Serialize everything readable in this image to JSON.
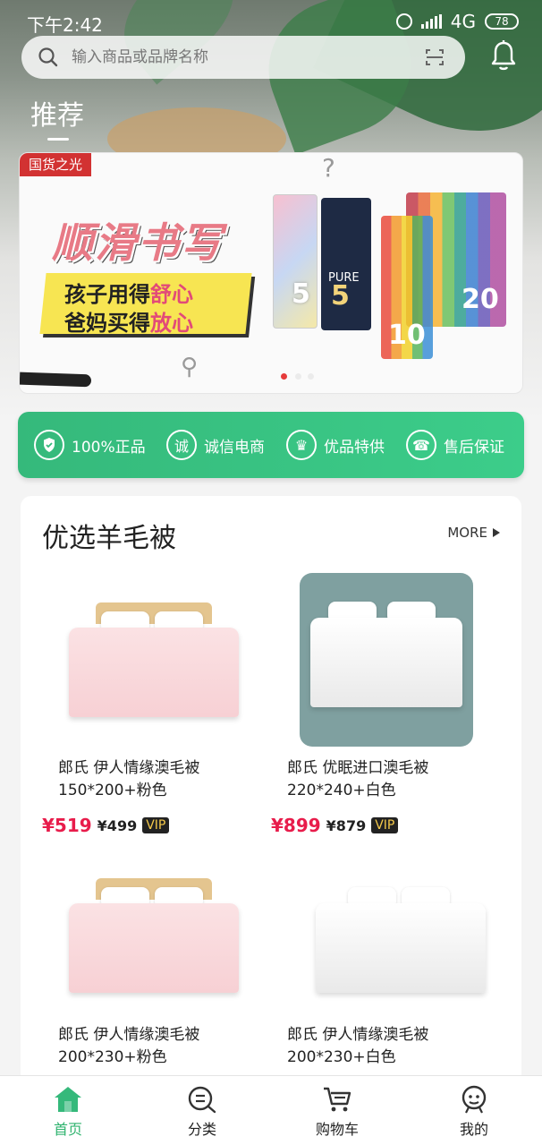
{
  "status_bar": {
    "time": "下午2:42",
    "network": "4G",
    "battery": "78"
  },
  "search": {
    "placeholder": "输入商品或品牌名称"
  },
  "top_tab": {
    "label": "推荐"
  },
  "banner": {
    "tag": "国货之光",
    "headline": "顺滑书写",
    "line1_prefix": "孩子用得",
    "line1_highlight": "舒心",
    "line2_prefix": "爸妈买得",
    "line2_highlight": "放心",
    "pack_label": "PURE",
    "pack_numbers": [
      "5",
      "5",
      "10",
      "20"
    ],
    "active_slide": 1,
    "slide_count": 3
  },
  "guarantees": [
    {
      "icon": "shield-icon",
      "label": "100%正品"
    },
    {
      "icon": "honest-icon",
      "label": "诚信电商"
    },
    {
      "icon": "crown-icon",
      "label": "优品特供"
    },
    {
      "icon": "service-icon",
      "label": "售后保证"
    }
  ],
  "section": {
    "title": "优选羊毛被",
    "more_label": "MORE"
  },
  "products": [
    {
      "name_line1": "郎氏 伊人情缘澳毛被",
      "name_line2": "150*200+粉色",
      "price": "¥519",
      "vip_price": "¥499",
      "vip_label": "VIP"
    },
    {
      "name_line1": "郎氏 优眠进口澳毛被",
      "name_line2": "220*240+白色",
      "price": "¥899",
      "vip_price": "¥879",
      "vip_label": "VIP"
    },
    {
      "name_line1": "郎氏 伊人情缘澳毛被",
      "name_line2": "200*230+粉色"
    },
    {
      "name_line1": "郎氏 伊人情缘澳毛被",
      "name_line2": "200*230+白色"
    }
  ],
  "bottom_nav": [
    {
      "label": "首页",
      "icon": "home-icon",
      "active": true
    },
    {
      "label": "分类",
      "icon": "category-icon",
      "active": false
    },
    {
      "label": "购物车",
      "icon": "cart-icon",
      "active": false
    },
    {
      "label": "我的",
      "icon": "profile-icon",
      "active": false
    }
  ],
  "colors": {
    "accent_green": "#35b97b",
    "price_red": "#e81c4b",
    "vip_gold": "#f4c94a"
  }
}
